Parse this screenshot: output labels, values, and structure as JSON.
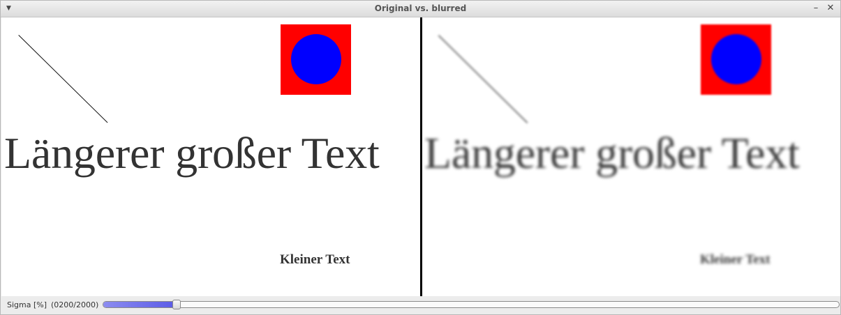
{
  "window": {
    "title": "Original vs. blurred",
    "menu_icon": "chevron-down-icon",
    "minimize_icon": "minimize-icon",
    "close_icon": "close-icon"
  },
  "canvas": {
    "original": {
      "large_text": "Längerer großer Text",
      "small_text": "Kleiner Text"
    },
    "blurred": {
      "large_text": "Längerer großer Text",
      "small_text": "Kleiner Text"
    },
    "colors": {
      "square": "#ff0000",
      "circle": "#0000ff",
      "divider": "#000000"
    }
  },
  "status": {
    "sigma_label": "Sigma [%]",
    "sigma_value": "(0200/2000)",
    "sigma_fraction": 0.1
  }
}
